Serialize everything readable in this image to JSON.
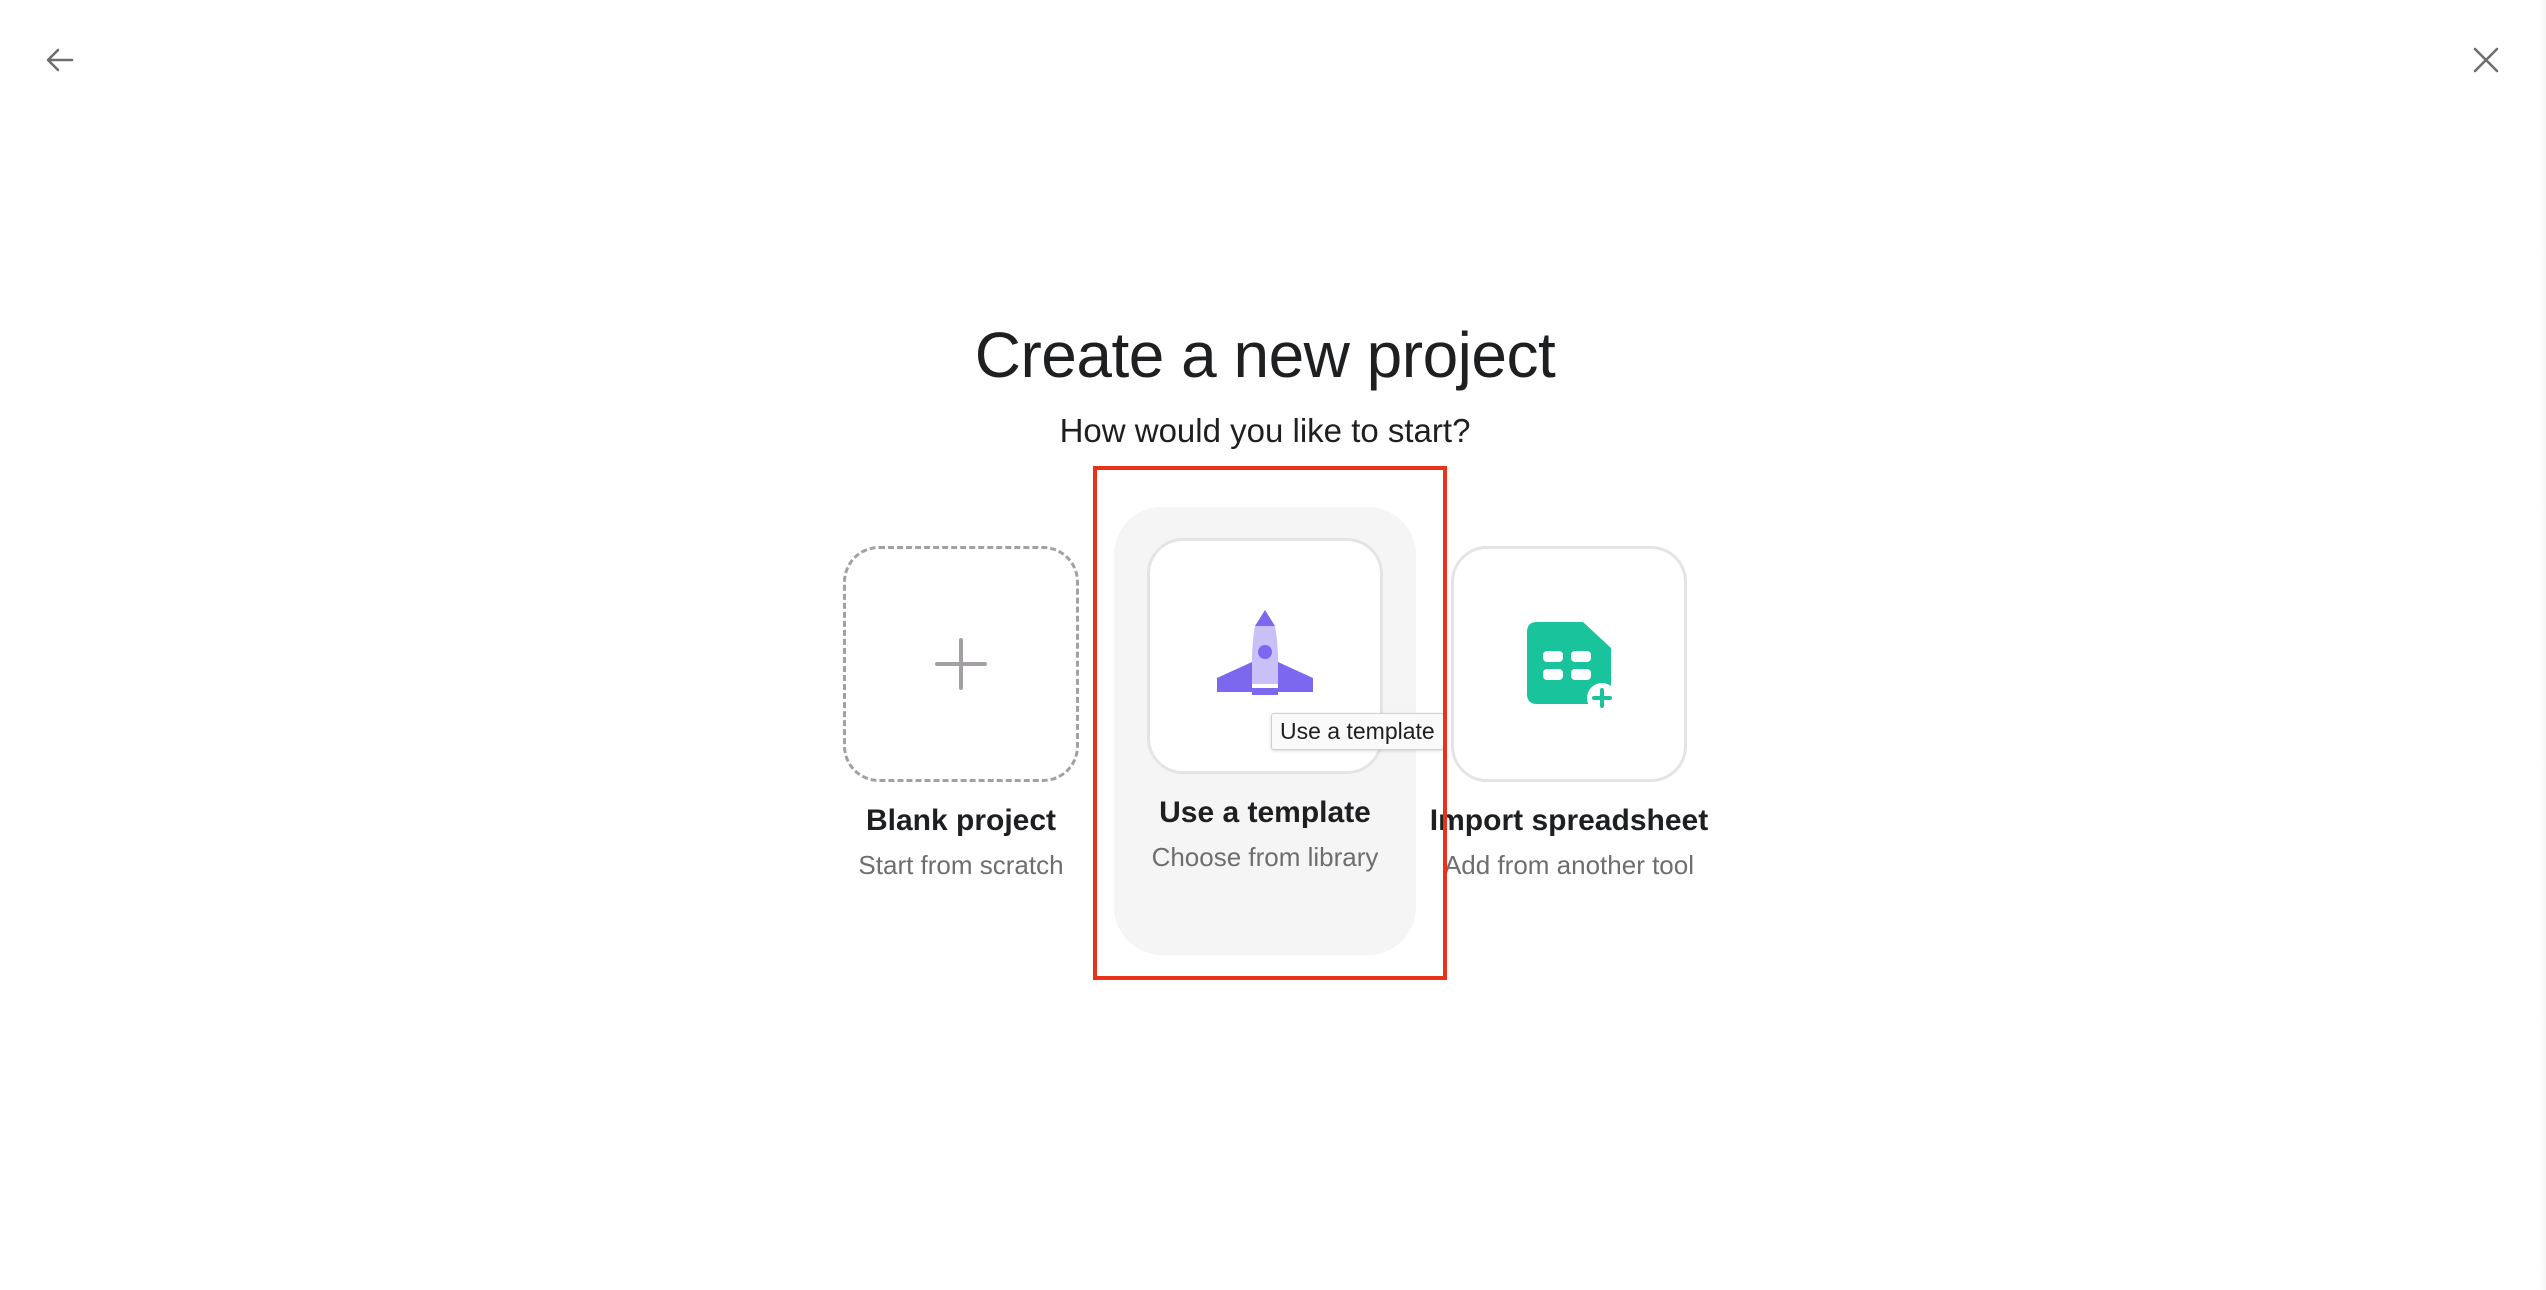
{
  "nav": {
    "back_icon": "arrow-left-icon",
    "close_icon": "close-icon"
  },
  "header": {
    "title": "Create a new project",
    "subtitle": "How would you like to start?"
  },
  "options": [
    {
      "label": "Blank project",
      "description": "Start from scratch",
      "icon": "plus-icon"
    },
    {
      "label": "Use a template",
      "description": "Choose from library",
      "icon": "rocket-icon"
    },
    {
      "label": "Import spreadsheet",
      "description": "Add from another tool",
      "icon": "spreadsheet-import-icon"
    }
  ],
  "tooltip": {
    "text": "Use a template"
  },
  "colors": {
    "highlight": "#e8321a",
    "rocket": "#7b68ee",
    "rocket_light": "#c9c0f7",
    "spreadsheet": "#19c39c"
  }
}
